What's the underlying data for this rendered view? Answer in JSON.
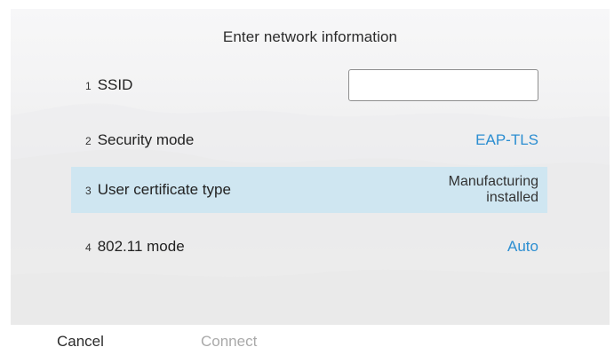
{
  "title": "Enter network information",
  "rows": [
    {
      "num": "1",
      "label": "SSID",
      "value": ""
    },
    {
      "num": "2",
      "label": "Security mode",
      "value": "EAP-TLS"
    },
    {
      "num": "3",
      "label": "User certificate type",
      "value_line1": "Manufacturing",
      "value_line2": "installed"
    },
    {
      "num": "4",
      "label": "802.11 mode",
      "value": "Auto"
    }
  ],
  "footer": {
    "cancel_label": "Cancel",
    "connect_label": "Connect"
  },
  "colors": {
    "accent": "#2c8ed1",
    "highlight": "#cfe6f1",
    "disabled": "#a9a9a9"
  }
}
